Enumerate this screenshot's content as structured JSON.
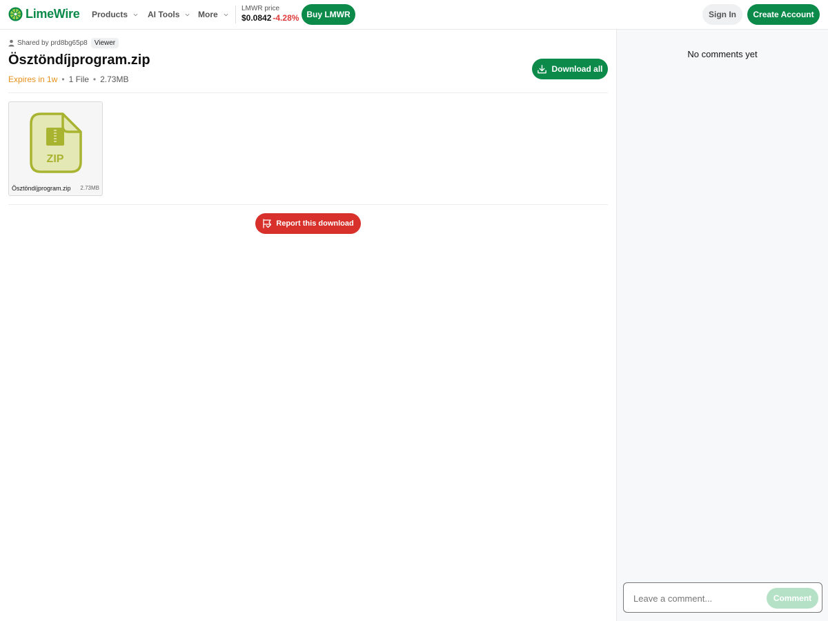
{
  "header": {
    "brand": "LimeWire",
    "nav": [
      {
        "label": "Products"
      },
      {
        "label": "AI Tools"
      },
      {
        "label": "More"
      }
    ],
    "price_label": "LMWR price",
    "price_value": "$0.0842",
    "price_change": "-4.28%",
    "buy_label": "Buy LMWR",
    "signin_label": "Sign In",
    "create_label": "Create Account"
  },
  "share": {
    "shared_by": "Shared by prd8bg65p8",
    "role": "Viewer",
    "title": "Ösztöndíjprogram.zip",
    "expires": "Expires in 1w",
    "file_count": "1 File",
    "total_size": "2.73MB",
    "download_all_label": "Download all"
  },
  "files": [
    {
      "name": "Ösztöndíjprogram.zip",
      "size": "2.73MB",
      "type_label": "ZIP"
    }
  ],
  "report_label": "Report this download",
  "comments": {
    "empty_text": "No comments yet",
    "placeholder": "Leave a comment...",
    "submit_label": "Comment"
  },
  "colors": {
    "brand_green": "#0b8a4a",
    "price_down": "#e03a3a",
    "expires_orange": "#e8901a",
    "report_red": "#d8302a",
    "zip_olive": "#a8b330"
  }
}
